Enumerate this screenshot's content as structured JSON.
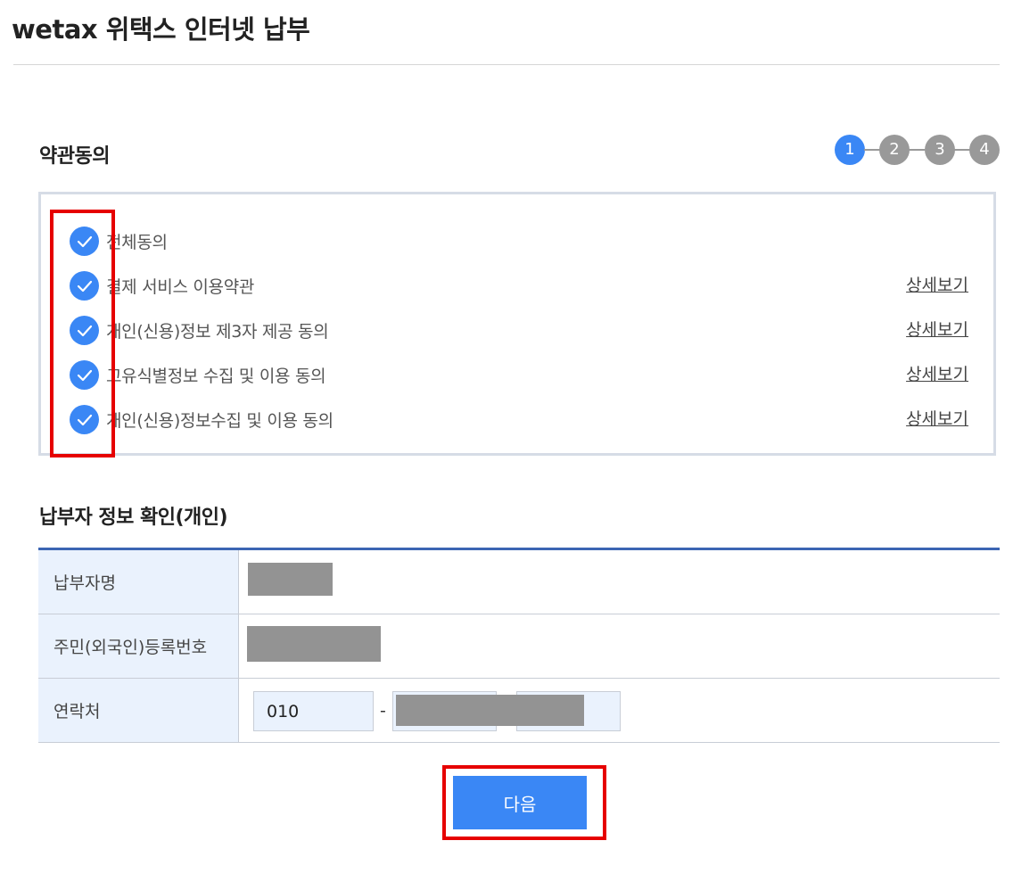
{
  "page": {
    "title": "wetax 위택스 인터넷 납부"
  },
  "terms_section": {
    "title": "약관동의",
    "steps": [
      "1",
      "2",
      "3",
      "4"
    ],
    "active_step": "1",
    "items": [
      {
        "label": "전체동의",
        "checked": true,
        "detail_label": ""
      },
      {
        "label": "결제 서비스 이용약관",
        "checked": true,
        "detail_label": "상세보기"
      },
      {
        "label": "개인(신용)정보 제3자 제공 동의",
        "checked": true,
        "detail_label": "상세보기"
      },
      {
        "label": "고유식별정보 수집 및 이용 동의",
        "checked": true,
        "detail_label": "상세보기"
      },
      {
        "label": "개인(신용)정보수집 및 이용 동의",
        "checked": true,
        "detail_label": "상세보기"
      }
    ]
  },
  "payer_section": {
    "title": "납부자 정보 확인(개인)",
    "rows": {
      "name_label": "납부자명",
      "id_label": "주민(외국인)등록번호",
      "phone_label": "연락처"
    },
    "phone": {
      "first": "010",
      "separator": "-"
    }
  },
  "next_button_label": "다음",
  "colors": {
    "accent": "#3a87f5",
    "step_inactive": "#999999",
    "table_header_bg": "#eaf2fd",
    "table_top_border": "#3c65b3",
    "highlight_box": "#e60000"
  }
}
